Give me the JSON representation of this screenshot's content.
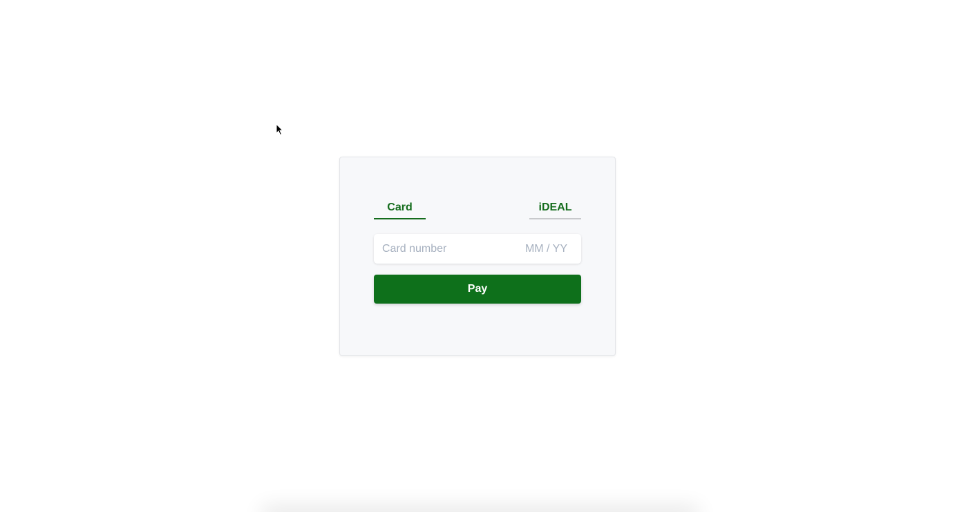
{
  "tabs": [
    {
      "label": "Card",
      "active": true
    },
    {
      "label": "iDEAL",
      "active": false
    }
  ],
  "card_input": {
    "number_placeholder": "Card number",
    "expiry_placeholder": "MM / YY"
  },
  "pay_button": {
    "label": "Pay"
  },
  "colors": {
    "accent": "#0e701b",
    "tab_text": "#146c1c",
    "placeholder": "#a6b0bf"
  }
}
